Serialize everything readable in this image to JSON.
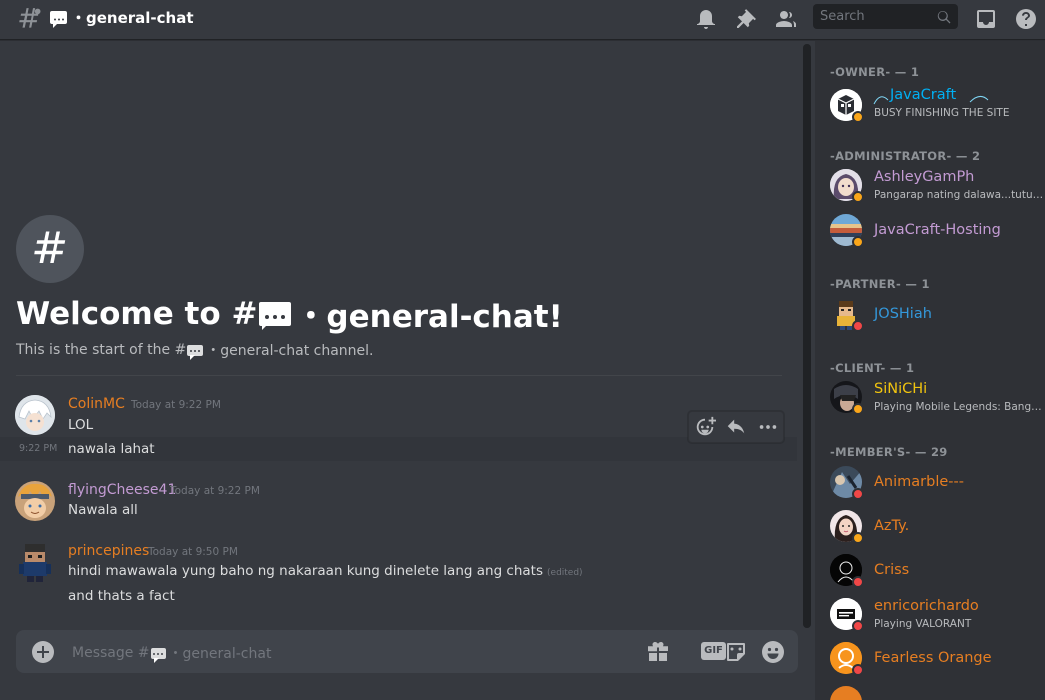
{
  "header": {
    "channel_name": "・general-chat",
    "search_placeholder": "Search"
  },
  "welcome": {
    "title_prefix": "Welcome to #",
    "title_suffix": "・general-chat!",
    "subtitle_prefix": "This is the start of the #",
    "subtitle_suffix": "・general-chat channel."
  },
  "messages": [
    {
      "author": "ColinMC",
      "author_color": "#e67e22",
      "timestamp": "Today at 9:22 PM",
      "lines": [
        "LOL"
      ],
      "followup": {
        "time": "9:22 PM",
        "text": "nawala lahat"
      }
    },
    {
      "author": "flyingCheese41",
      "author_color": "#c39bd3",
      "timestamp": "Today at 9:22 PM",
      "lines": [
        "Nawala all"
      ]
    },
    {
      "author": "princepines",
      "author_color": "#e67e22",
      "timestamp": "Today at 9:50 PM",
      "lines": [
        "hindi mawawala yung baho ng nakaraan kung dinelete lang ang chats",
        "and thats a fact"
      ],
      "edited": "(edited)"
    }
  ],
  "composer": {
    "placeholder_prefix": "Message #",
    "placeholder_suffix": "・general-chat",
    "gif_label": "GIF"
  },
  "members": {
    "groups": [
      {
        "label": "-OWNER- — 1"
      },
      {
        "label": "-ADMINISTRATOR- — 2"
      },
      {
        "label": "-PARTNER- — 1"
      },
      {
        "label": "-CLIENT- — 1"
      },
      {
        "label": "-MEMBER'S- — 29"
      }
    ],
    "list": [
      {
        "name": "JavaCraft",
        "color": "#00b0f4",
        "activity": "BUSY FINISHING THE SITE",
        "status": "idle"
      },
      {
        "name": "AshleyGamPh",
        "color": "#c39bd3",
        "activity": "Pangarap nating dalawa...tutuparin ko",
        "status": "idle"
      },
      {
        "name": "JavaCraft-Hosting",
        "color": "#c39bd3",
        "activity": "",
        "status": "idle"
      },
      {
        "name": "JOSHiah",
        "color": "#3498db",
        "activity": "",
        "status": "dnd"
      },
      {
        "name": "SiNiCHi",
        "color": "#f1c40f",
        "activity": "Playing Mobile Legends: Bang Bang",
        "status": "idle"
      },
      {
        "name": "Animarble---",
        "color": "#e67e22",
        "activity": "",
        "status": "dnd"
      },
      {
        "name": "AzTy.",
        "color": "#e67e22",
        "activity": "",
        "status": "idle"
      },
      {
        "name": "Criss",
        "color": "#e67e22",
        "activity": "",
        "status": "dnd"
      },
      {
        "name": "enricorichardo",
        "color": "#e67e22",
        "activity": "Playing VALORANT",
        "status": "dnd"
      },
      {
        "name": "Fearless Orange",
        "color": "#e67e22",
        "activity": "",
        "status": "dnd"
      }
    ]
  }
}
